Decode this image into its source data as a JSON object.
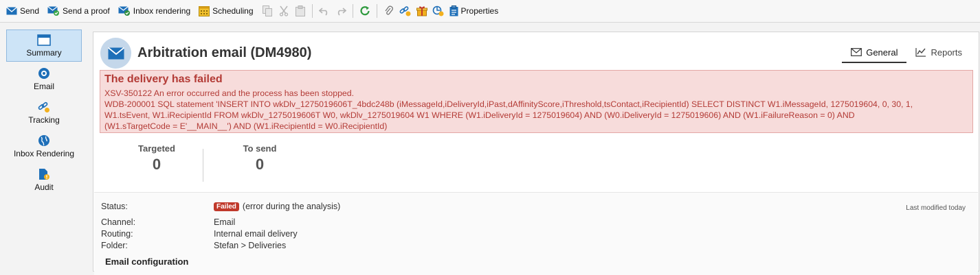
{
  "toolbar": {
    "send_label": "Send",
    "proof_label": "Send a proof",
    "inbox_label": "Inbox rendering",
    "scheduling_label": "Scheduling",
    "properties_label": "Properties"
  },
  "nav": {
    "summary": "Summary",
    "email": "Email",
    "tracking": "Tracking",
    "inbox_rendering": "Inbox Rendering",
    "audit": "Audit"
  },
  "header": {
    "title": "Arbitration email (DM4980)",
    "tab_general": "General",
    "tab_reports": "Reports"
  },
  "error": {
    "title": "The delivery has failed",
    "line1": "XSV-350122 An error occurred and the process has been stopped.",
    "line2": "WDB-200001 SQL statement 'INSERT INTO wkDlv_1275019606T_4bdc248b (iMessageId,iDeliveryId,iPast,dAffinityScore,iThreshold,tsContact,iRecipientId) SELECT DISTINCT W1.iMessageId, 1275019604, 0, 30, 1,",
    "line3": "W1.tsEvent, W1.iRecipientId FROM wkDlv_1275019606T W0, wkDlv_1275019604 W1 WHERE (W1.iDeliveryId = 1275019604) AND (W0.iDeliveryId = 1275019606) AND (W1.iFailureReason = 0) AND",
    "line4": "(W1.sTargetCode = E'__MAIN__') AND (W1.iRecipientId = W0.iRecipientId)"
  },
  "stats": {
    "targeted_label": "Targeted",
    "targeted_value": "0",
    "tosend_label": "To send",
    "tosend_value": "0"
  },
  "details": {
    "status_label": "Status:",
    "status_badge": "Failed",
    "status_text": "(error during the analysis)",
    "channel_label": "Channel:",
    "channel_value": "Email",
    "routing_label": "Routing:",
    "routing_value": "Internal email delivery",
    "folder_label": "Folder:",
    "folder_value": "Stefan > Deliveries",
    "modified": "Last modified today",
    "section": "Email configuration"
  },
  "colors": {
    "accent": "#1e6fb8",
    "error_bg": "#f7dcdb",
    "error_text": "#b33b36",
    "badge": "#c0392b"
  },
  "icons": [
    "envelope-icon",
    "proof-icon",
    "inbox-icon",
    "calendar-icon",
    "copy-icon",
    "cut-icon",
    "paste-icon",
    "undo-icon",
    "redo-icon",
    "refresh-icon",
    "attachment-icon",
    "link-icon",
    "gift-icon",
    "tracking-icon",
    "clipboard-icon"
  ]
}
